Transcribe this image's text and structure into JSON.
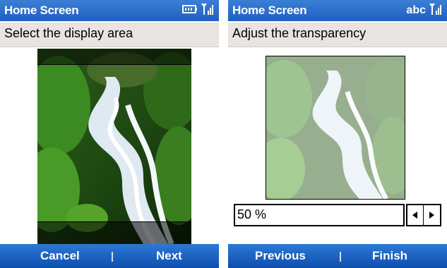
{
  "left_screen": {
    "title": "Home Screen",
    "status_icons": [
      "battery-icon",
      "signal-icon"
    ],
    "instruction": "Select the display area",
    "softkeys": {
      "left": "Cancel",
      "right": "Next"
    }
  },
  "right_screen": {
    "title": "Home Screen",
    "input_mode": "abc",
    "status_icons": [
      "signal-icon"
    ],
    "instruction": "Adjust the transparency",
    "transparency_value": "50 %",
    "transparency_level": 0.5,
    "softkeys": {
      "left": "Previous",
      "right": "Finish"
    }
  },
  "colors": {
    "title_bar": "#1f5fc0",
    "softkey_bar": "#0e4fae",
    "subheader": "#e7e4e1"
  }
}
